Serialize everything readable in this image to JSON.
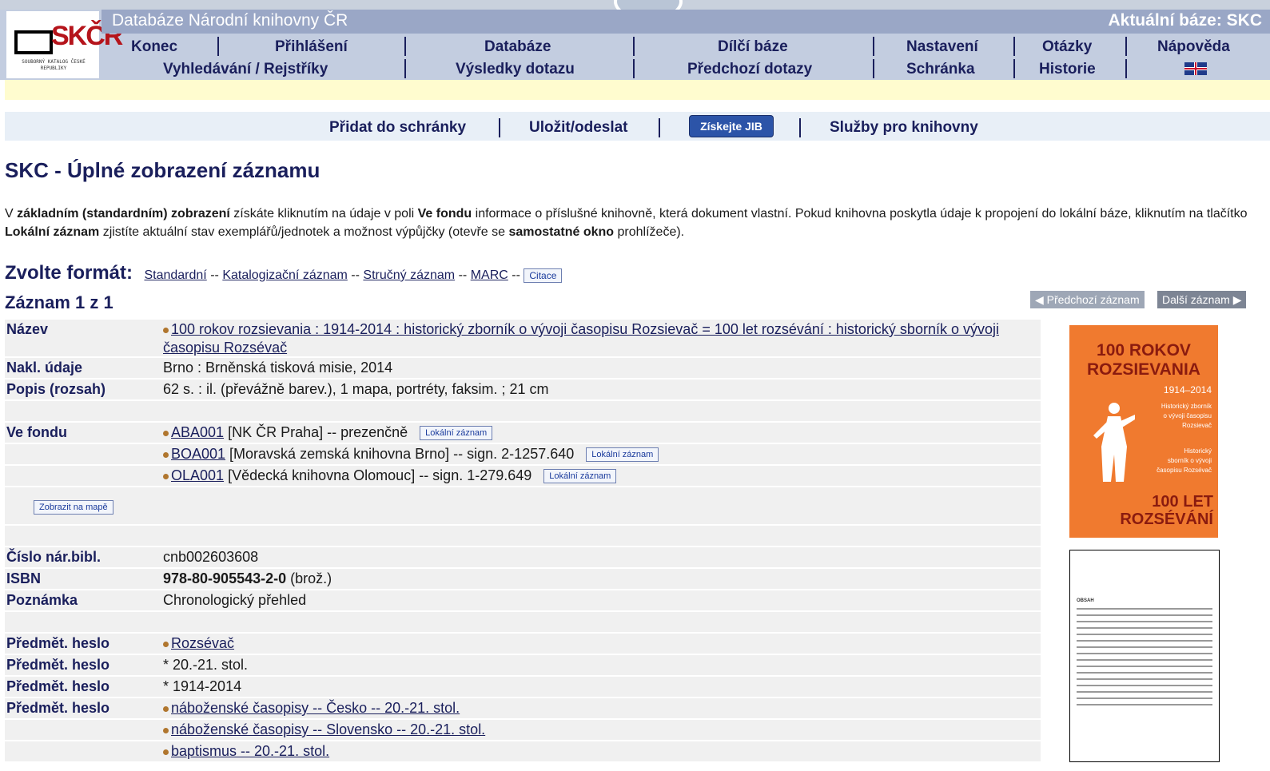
{
  "header": {
    "database_title": "Databáze Národní knihovny ČR",
    "current_base": "Aktuální báze: SKC",
    "logo_text": "SKČR",
    "logo_subtitle": "SOUBORNÝ KATALOG ČESKÉ REPUBLIKY",
    "nav_row1": [
      "Konec",
      "Přihlášení",
      "Databáze",
      "Dílčí báze",
      "Nastavení",
      "Otázky",
      "Nápověda"
    ],
    "nav_row2": [
      "Vyhledávání / Rejstříky",
      "Výsledky dotazu",
      "Předchozí dotazy",
      "Schránka",
      "Historie"
    ]
  },
  "actions": {
    "add_to_cart": "Přidat do schránky",
    "save_send": "Uložit/odeslat",
    "jib_button": "Získejte JIB",
    "library_services": "Služby pro knihovny"
  },
  "page": {
    "title": "SKC - Úplné zobrazení záznamu",
    "info_p1": "V ",
    "info_b1": "základním (standardním) zobrazení",
    "info_p2": " získáte kliknutím na údaje v poli ",
    "info_b2": "Ve fondu",
    "info_p3": " informace o příslušné knihovně, která dokument vlastní. Pokud knihovna poskytla údaje k propojení do lokální báze, kliknutím na tlačítko ",
    "info_b3": "Lokální záznam",
    "info_p4": " zjistíte aktuální stav exemplářů/jednotek a možnost výpůjčky (otevře se ",
    "info_b4": "samostatné okno",
    "info_p5": " prohlížeče)."
  },
  "format": {
    "label": "Zvolte formát:",
    "standard": "Standardní",
    "catalog": "Katalogizační záznam",
    "short": "Stručný záznam",
    "marc": "MARC",
    "citation": "Citace",
    "separator": "--"
  },
  "record": {
    "heading": "Záznam 1 z 1",
    "prev": "◀ Předchozí záznam",
    "next": "Další záznam ▶",
    "rows": {
      "title_label": "Název",
      "title_value": "100 rokov rozsievania : 1914-2014 : historický zborník o vývoji časopisu Rozsievač = 100 let rozsévání : historický sborník o vývoji časopisu Rozsévač",
      "publisher_label": "Nakl. údaje",
      "publisher_value": "Brno : Brněnská tisková misie, 2014",
      "extent_label": "Popis (rozsah)",
      "extent_value": "62 s. : il. (převážně barev.), 1 mapa, portréty, faksim. ; 21 cm",
      "holdings_label": "Ve fondu",
      "h1_code": "ABA001",
      "h1_text": " [NK ČR Praha] -- prezenčně",
      "h2_code": "BOA001",
      "h2_text": " [Moravská zemská knihovna Brno] -- sign. 2-1257.640",
      "h3_code": "OLA001",
      "h3_text": " [Vědecká knihovna Olomouc] -- sign. 1-279.649",
      "local_record": "Lokální záznam",
      "show_map": "Zobrazit na mapě",
      "cnb_label": "Číslo nár.bibl.",
      "cnb_value": "cnb002603608",
      "isbn_label": "ISBN",
      "isbn_value": "978-80-905543-2-0",
      "isbn_note": " (brož.)",
      "note_label": "Poznámka",
      "note_value": "Chronologický přehled",
      "subject_label": "Předmět. heslo",
      "s1": "Rozsévač",
      "s2": "* 20.-21. stol.",
      "s3": "* 1914-2014",
      "s4": "náboženské časopisy -- Česko -- 20.-21. stol.",
      "s5": "náboženské časopisy -- Slovensko -- 20.-21. stol.",
      "s6": "baptismus -- 20.-21. stol."
    }
  },
  "cover": {
    "title_line1": "100 ROKOV",
    "title_line2": "ROZSIEVANIA",
    "years": "1914–2014",
    "desc_l1": "Historický zborník",
    "desc_l2": "o vývoji časopisu",
    "desc_l3": "Rozsievač",
    "desc2_l1": "Historický",
    "desc2_l2": "sborník o vývoji",
    "desc2_l3": "časopisu Rozsévač",
    "bottom_line1": "100 LET",
    "bottom_line2": "ROZSÉVÁNÍ"
  },
  "toc": {
    "heading": "OBSAH"
  }
}
